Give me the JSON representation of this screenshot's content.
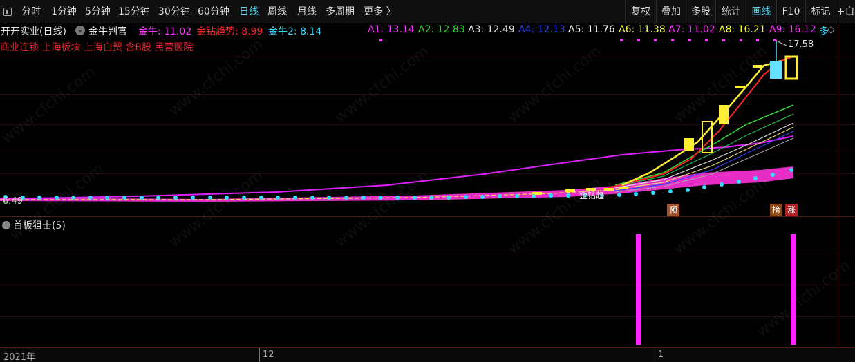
{
  "toolbar": {
    "periods": [
      {
        "label": "分时"
      },
      {
        "label": "1分钟"
      },
      {
        "label": "5分钟"
      },
      {
        "label": "15分钟"
      },
      {
        "label": "30分钟"
      },
      {
        "label": "60分钟"
      },
      {
        "label": "日线",
        "active": true
      },
      {
        "label": "周线"
      },
      {
        "label": "月线"
      },
      {
        "label": "多周期"
      },
      {
        "label": "更多 〉"
      }
    ],
    "right_buttons": [
      {
        "label": "复权"
      },
      {
        "label": "叠加"
      },
      {
        "label": "多股"
      },
      {
        "label": "统计"
      },
      {
        "label": "画线",
        "active": true
      },
      {
        "label": "F10"
      },
      {
        "label": "标记"
      },
      {
        "label": "+自"
      }
    ]
  },
  "info": {
    "stock_name": "开开实业(日线)",
    "indicator_name": "金牛判官",
    "jinniu": "金牛: 11.02",
    "jinzuan": "金钻趋势: 8.99",
    "jinniu2": "金牛2: 8.14",
    "a_values": [
      {
        "text": "A1: 13.14",
        "color": "#ff33ff"
      },
      {
        "text": "A2: 12.83",
        "color": "#33dd33"
      },
      {
        "text": "A3: 12.49",
        "color": "#dddddd"
      },
      {
        "text": "A4: 12.13",
        "color": "#3344ff"
      },
      {
        "text": "A5: 11.76",
        "color": "#ffffff"
      },
      {
        "text": "A6: 11.38",
        "color": "#ffff66"
      },
      {
        "text": "A7: 11.02",
        "color": "#ff33ff"
      },
      {
        "text": "A8: 16.21",
        "color": "#ffff33"
      },
      {
        "text": "A9: 16.12",
        "color": "#ff33ff"
      }
    ],
    "more_glyph": "多",
    "diamond": "◇"
  },
  "tags": "商业连锁 上海板块 上海自贸 含B股 民营医院",
  "price_high": "17.58",
  "price_low": "6.49",
  "badges": {
    "yu": "预",
    "bang": "榜",
    "zhang": "涨"
  },
  "ma_label": "金钻趋",
  "indicator_panel": {
    "title": "首板狙击(5)",
    "bar_color": "#ff22ff"
  },
  "time_axis": {
    "labels": [
      "2021年",
      "12",
      "1"
    ]
  },
  "watermark": "www.cfchi.com",
  "colors": {
    "jinniu": "#ff33ff",
    "jinzuan": "#ff2222",
    "jinniu2": "#33ddff",
    "active": "#4fd3f0",
    "candle_up": "#ffee33",
    "candle_cyan": "#66e0ff"
  }
}
